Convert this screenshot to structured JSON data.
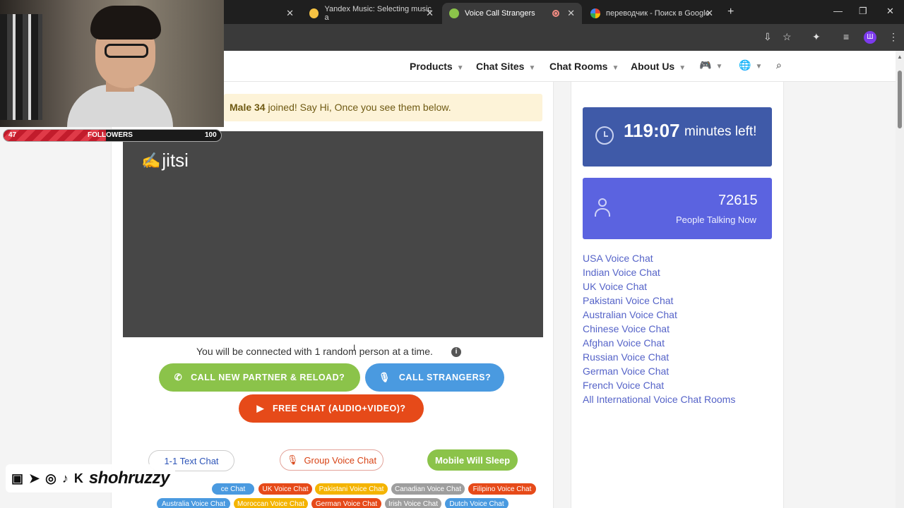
{
  "browser": {
    "tabs": [
      {
        "title": "Yandex Music: Selecting music a",
        "active": false
      },
      {
        "title": "Voice Call Strangers",
        "active": true
      },
      {
        "title": "переводчик - Поиск в Google",
        "active": false
      }
    ],
    "profile_initial": "Ш"
  },
  "nav": {
    "items": [
      "Products",
      "Chat Sites",
      "Chat Rooms",
      "About Us"
    ]
  },
  "main": {
    "joined_user": "Male 34",
    "joined_text": " joined! Say Hi, Once you see them below.",
    "video_brand": "jitsi",
    "connect_text": "You will be connected with 1 random person at a time.",
    "buttons": {
      "call_new": "CALL NEW PARTNER & RELOAD?",
      "call_strangers": "CALL STRANGERS?",
      "free_chat": "FREE CHAT (AUDIO+VIDEO)?"
    },
    "pills": {
      "text_chat": "1-1 Text Chat",
      "group_voice": "Group Voice Chat",
      "mobile_sleep": "Mobile Will Sleep"
    },
    "tags_row1": [
      {
        "label": "ce Chat",
        "color": "#4a9ae0"
      },
      {
        "label": "UK Voice Chat",
        "color": "#e64a19"
      },
      {
        "label": "Pakistani Voice Chat",
        "color": "#f4b400"
      },
      {
        "label": "Canadian Voice Chat",
        "color": "#9e9e9e"
      },
      {
        "label": "Filipino Voice Chat",
        "color": "#e64a19"
      }
    ],
    "tags_row2": [
      {
        "label": "Australia Voice Chat",
        "color": "#4a9ae0"
      },
      {
        "label": "Moroccan Voice Chat",
        "color": "#f4b400"
      },
      {
        "label": "German Voice Chat",
        "color": "#e64a19"
      },
      {
        "label": "Irish Voice Chat",
        "color": "#9e9e9e"
      },
      {
        "label": "Dutch Voice Chat",
        "color": "#4a9ae0"
      }
    ]
  },
  "sidebar": {
    "timer_value": "119:07",
    "timer_label": "minutes left!",
    "people_count": "72615",
    "people_label": "People Talking Now",
    "links": [
      "USA Voice Chat",
      "Indian Voice Chat",
      "UK Voice Chat",
      "Pakistani Voice Chat",
      "Australian Voice Chat",
      "Chinese Voice Chat",
      "Afghan Voice Chat",
      "Russian Voice Chat",
      "German Voice Chat",
      "French Voice Chat",
      "All International Voice Chat Rooms"
    ]
  },
  "overlay": {
    "followers_current": "47",
    "followers_label": "FOLLOWERS",
    "followers_goal": "100",
    "followers_progress": 0.47,
    "handle": "shohruzzy"
  },
  "colors": {
    "green": "#8bc34a",
    "blue": "#4a9ae0",
    "red": "#e64a19",
    "timer_bg": "#3f5aa8",
    "people_bg": "#5b63e0",
    "link": "#5563c8"
  }
}
